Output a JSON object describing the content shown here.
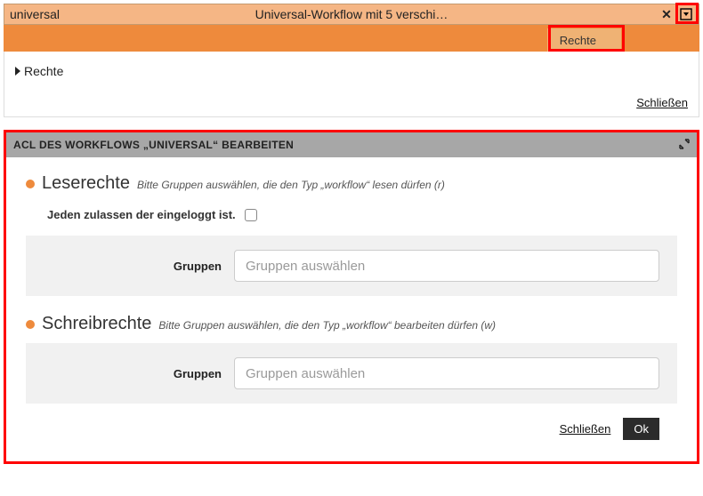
{
  "titlebar": {
    "name": "universal",
    "title": "Universal-Workflow mit 5 verschi…",
    "close_icon": "✕",
    "menu_icon": "▾"
  },
  "tabs": {
    "rechte": "Rechte"
  },
  "breadcrumb": {
    "label": "Rechte"
  },
  "top": {
    "close_link": "Schließen"
  },
  "panel": {
    "header": "ACL DES WORKFLOWS „UNIVERSAL“ BEARBEITEN",
    "read": {
      "title": "Leserechte",
      "hint": "Bitte Gruppen auswählen, die den Typ „workflow“ lesen dürfen (r)",
      "allow_everyone": "Jeden zulassen der eingeloggt ist.",
      "groups_label": "Gruppen",
      "groups_placeholder": "Gruppen auswählen"
    },
    "write": {
      "title": "Schreibrechte",
      "hint": "Bitte Gruppen auswählen, die den Typ „workflow“ bearbeiten dürfen (w)",
      "groups_label": "Gruppen",
      "groups_placeholder": "Gruppen auswählen"
    },
    "footer": {
      "close": "Schließen",
      "ok": "Ok"
    }
  },
  "colors": {
    "accent_orange": "#ee8a3c",
    "highlight_red": "#ff0000"
  }
}
